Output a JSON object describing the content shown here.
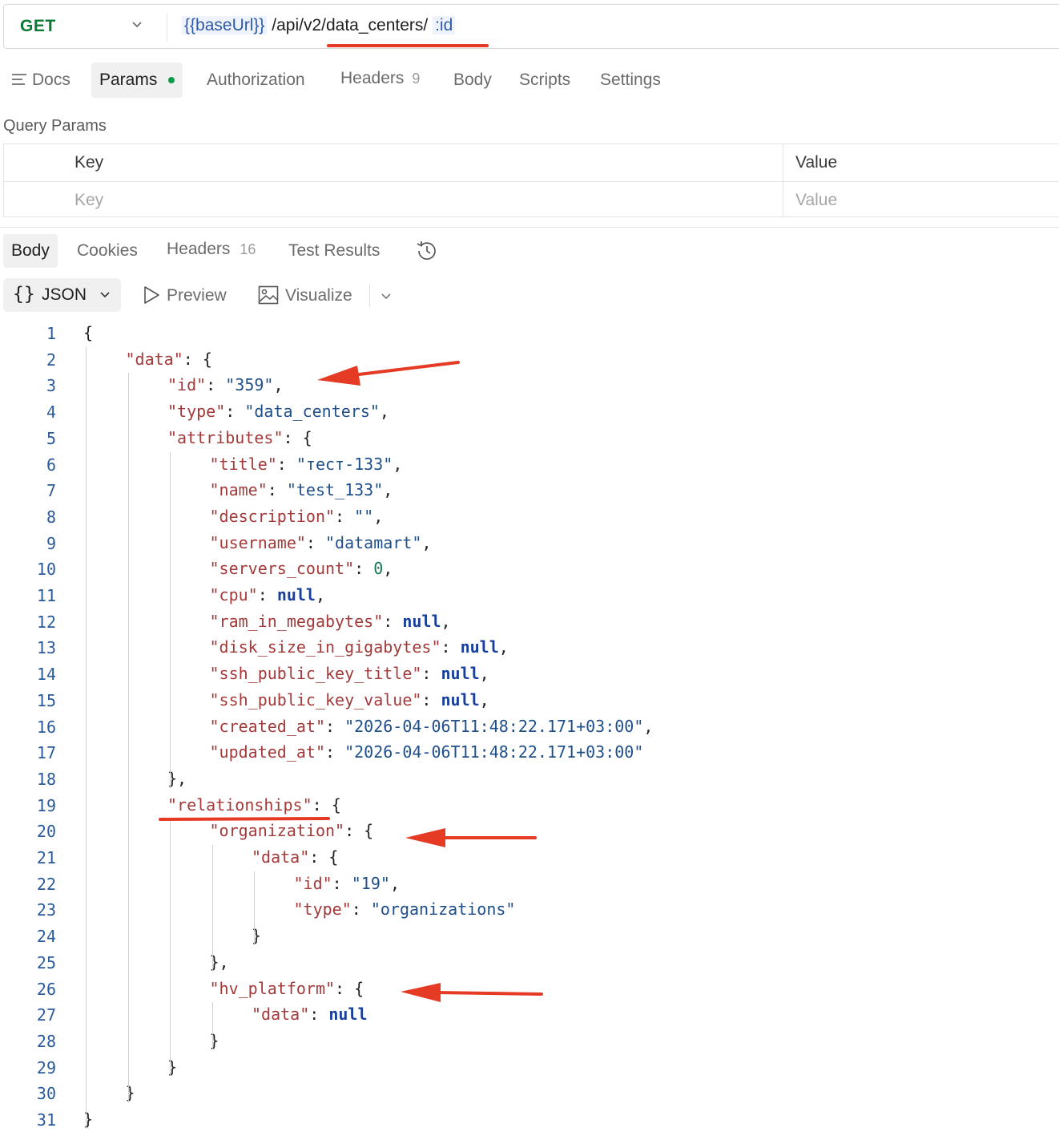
{
  "request": {
    "method": "GET",
    "url_var": "{{baseUrl}}",
    "url_path": " /api/v2/data_centers/ ",
    "url_param": ":id"
  },
  "request_tabs": [
    {
      "label": "Docs",
      "icon": "list-icon"
    },
    {
      "label": "Params",
      "active": true,
      "indicator": "green-dot"
    },
    {
      "label": "Authorization"
    },
    {
      "label": "Headers",
      "count": "9"
    },
    {
      "label": "Body"
    },
    {
      "label": "Scripts"
    },
    {
      "label": "Settings"
    }
  ],
  "query_params": {
    "title": "Query Params",
    "header_key": "Key",
    "header_value": "Value",
    "placeholder_key": "Key",
    "placeholder_value": "Value"
  },
  "response_tabs": [
    {
      "label": "Body",
      "active": true
    },
    {
      "label": "Cookies"
    },
    {
      "label": "Headers",
      "count": "16"
    },
    {
      "label": "Test Results"
    }
  ],
  "format_bar": {
    "json_braces": "{}",
    "json_label": "JSON",
    "preview_label": "Preview",
    "visualize_label": "Visualize"
  },
  "code_lines": [
    {
      "n": "1",
      "indent": 0,
      "parts": [
        [
          "p",
          "{"
        ]
      ]
    },
    {
      "n": "2",
      "indent": 1,
      "parts": [
        [
          "k",
          "\"data\""
        ],
        [
          "p",
          ": {"
        ]
      ]
    },
    {
      "n": "3",
      "indent": 2,
      "parts": [
        [
          "k",
          "\"id\""
        ],
        [
          "p",
          ": "
        ],
        [
          "s",
          "\"359\""
        ],
        [
          "p",
          ","
        ]
      ]
    },
    {
      "n": "4",
      "indent": 2,
      "parts": [
        [
          "k",
          "\"type\""
        ],
        [
          "p",
          ": "
        ],
        [
          "s",
          "\"data_centers\""
        ],
        [
          "p",
          ","
        ]
      ]
    },
    {
      "n": "5",
      "indent": 2,
      "parts": [
        [
          "k",
          "\"attributes\""
        ],
        [
          "p",
          ": {"
        ]
      ]
    },
    {
      "n": "6",
      "indent": 3,
      "parts": [
        [
          "k",
          "\"title\""
        ],
        [
          "p",
          ": "
        ],
        [
          "s",
          "\"тест-133\""
        ],
        [
          "p",
          ","
        ]
      ]
    },
    {
      "n": "7",
      "indent": 3,
      "parts": [
        [
          "k",
          "\"name\""
        ],
        [
          "p",
          ": "
        ],
        [
          "s",
          "\"test_133\""
        ],
        [
          "p",
          ","
        ]
      ]
    },
    {
      "n": "8",
      "indent": 3,
      "parts": [
        [
          "k",
          "\"description\""
        ],
        [
          "p",
          ": "
        ],
        [
          "s",
          "\"\""
        ],
        [
          "p",
          ","
        ]
      ]
    },
    {
      "n": "9",
      "indent": 3,
      "parts": [
        [
          "k",
          "\"username\""
        ],
        [
          "p",
          ": "
        ],
        [
          "s",
          "\"datamart\""
        ],
        [
          "p",
          ","
        ]
      ]
    },
    {
      "n": "10",
      "indent": 3,
      "parts": [
        [
          "k",
          "\"servers_count\""
        ],
        [
          "p",
          ": "
        ],
        [
          "n",
          "0"
        ],
        [
          "p",
          ","
        ]
      ]
    },
    {
      "n": "11",
      "indent": 3,
      "parts": [
        [
          "k",
          "\"cpu\""
        ],
        [
          "p",
          ": "
        ],
        [
          "nl",
          "null"
        ],
        [
          "p",
          ","
        ]
      ]
    },
    {
      "n": "12",
      "indent": 3,
      "parts": [
        [
          "k",
          "\"ram_in_megabytes\""
        ],
        [
          "p",
          ": "
        ],
        [
          "nl",
          "null"
        ],
        [
          "p",
          ","
        ]
      ]
    },
    {
      "n": "13",
      "indent": 3,
      "parts": [
        [
          "k",
          "\"disk_size_in_gigabytes\""
        ],
        [
          "p",
          ": "
        ],
        [
          "nl",
          "null"
        ],
        [
          "p",
          ","
        ]
      ]
    },
    {
      "n": "14",
      "indent": 3,
      "parts": [
        [
          "k",
          "\"ssh_public_key_title\""
        ],
        [
          "p",
          ": "
        ],
        [
          "nl",
          "null"
        ],
        [
          "p",
          ","
        ]
      ]
    },
    {
      "n": "15",
      "indent": 3,
      "parts": [
        [
          "k",
          "\"ssh_public_key_value\""
        ],
        [
          "p",
          ": "
        ],
        [
          "nl",
          "null"
        ],
        [
          "p",
          ","
        ]
      ]
    },
    {
      "n": "16",
      "indent": 3,
      "parts": [
        [
          "k",
          "\"created_at\""
        ],
        [
          "p",
          ": "
        ],
        [
          "s",
          "\"2026-04-06T11:48:22.171+03:00\""
        ],
        [
          "p",
          ","
        ]
      ]
    },
    {
      "n": "17",
      "indent": 3,
      "parts": [
        [
          "k",
          "\"updated_at\""
        ],
        [
          "p",
          ": "
        ],
        [
          "s",
          "\"2026-04-06T11:48:22.171+03:00\""
        ]
      ]
    },
    {
      "n": "18",
      "indent": 2,
      "parts": [
        [
          "p",
          "},"
        ]
      ]
    },
    {
      "n": "19",
      "indent": 2,
      "parts": [
        [
          "k",
          "\"relationships\""
        ],
        [
          "p",
          ": {"
        ]
      ]
    },
    {
      "n": "20",
      "indent": 3,
      "parts": [
        [
          "k",
          "\"organization\""
        ],
        [
          "p",
          ": {"
        ]
      ]
    },
    {
      "n": "21",
      "indent": 4,
      "parts": [
        [
          "k",
          "\"data\""
        ],
        [
          "p",
          ": {"
        ]
      ]
    },
    {
      "n": "22",
      "indent": 5,
      "parts": [
        [
          "k",
          "\"id\""
        ],
        [
          "p",
          ": "
        ],
        [
          "s",
          "\"19\""
        ],
        [
          "p",
          ","
        ]
      ]
    },
    {
      "n": "23",
      "indent": 5,
      "parts": [
        [
          "k",
          "\"type\""
        ],
        [
          "p",
          ": "
        ],
        [
          "s",
          "\"organizations\""
        ]
      ]
    },
    {
      "n": "24",
      "indent": 4,
      "parts": [
        [
          "p",
          "}"
        ]
      ]
    },
    {
      "n": "25",
      "indent": 3,
      "parts": [
        [
          "p",
          "},"
        ]
      ]
    },
    {
      "n": "26",
      "indent": 3,
      "parts": [
        [
          "k",
          "\"hv_platform\""
        ],
        [
          "p",
          ": {"
        ]
      ]
    },
    {
      "n": "27",
      "indent": 4,
      "parts": [
        [
          "k",
          "\"data\""
        ],
        [
          "p",
          ": "
        ],
        [
          "nl",
          "null"
        ]
      ]
    },
    {
      "n": "28",
      "indent": 3,
      "parts": [
        [
          "p",
          "}"
        ]
      ]
    },
    {
      "n": "29",
      "indent": 2,
      "parts": [
        [
          "p",
          "}"
        ]
      ]
    },
    {
      "n": "30",
      "indent": 1,
      "parts": [
        [
          "p",
          "}"
        ]
      ]
    },
    {
      "n": "31",
      "indent": 0,
      "parts": [
        [
          "p",
          "}"
        ]
      ]
    }
  ],
  "annotation_color": "#e53a24",
  "annotations": [
    "underline-url-path",
    "arrow-id",
    "underline-relationships",
    "arrow-organization",
    "arrow-hv-platform"
  ]
}
